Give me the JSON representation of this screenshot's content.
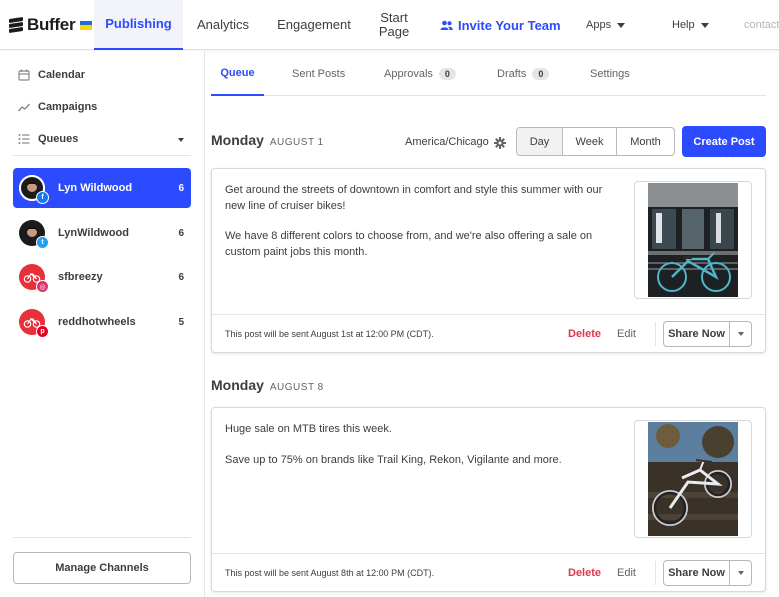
{
  "brand": {
    "name": "Buffer",
    "flag_colors": [
      "#1f6cd3",
      "#ffd500"
    ]
  },
  "nav": {
    "tabs": [
      {
        "label": "Publishing",
        "active": true
      },
      {
        "label": "Analytics"
      },
      {
        "label": "Engagement"
      },
      {
        "label": "Start Page"
      }
    ],
    "invite": "Invite Your Team",
    "apps": "Apps",
    "help": "Help",
    "contact": "contact"
  },
  "sidebar": {
    "calendar": "Calendar",
    "campaigns": "Campaigns",
    "queues": "Queues",
    "channels": [
      {
        "name": "Lyn Wildwood",
        "count": "6",
        "network": "facebook",
        "badge_color": "#1877f2",
        "active": true
      },
      {
        "name": "LynWildwood",
        "count": "6",
        "network": "twitter",
        "badge_color": "#1da1f2"
      },
      {
        "name": "sfbreezy",
        "count": "6",
        "network": "instagram",
        "badge_color": "#e1306c"
      },
      {
        "name": "reddhotwheels",
        "count": "5",
        "network": "pinterest",
        "badge_color": "#e60023"
      }
    ],
    "manage_label": "Manage Channels"
  },
  "tabs": {
    "queue": "Queue",
    "sent": "Sent Posts",
    "approvals": "Approvals",
    "approvals_count": "0",
    "drafts": "Drafts",
    "drafts_count": "0",
    "settings": "Settings"
  },
  "toolbar": {
    "timezone": "America/Chicago",
    "views": [
      "Day",
      "Week",
      "Month"
    ],
    "selected_view": "Day",
    "create_label": "Create Post"
  },
  "days": [
    {
      "name": "Monday",
      "date": "AUGUST 1",
      "post": {
        "paragraphs": [
          "Get around the streets of downtown in comfort and style this summer with our new line of cruiser bikes!",
          "We have 8 different colors to choose from, and we're also offering a sale on custom paint jobs this month."
        ],
        "note": "This post will be sent August 1st at 12:00 PM (CDT).",
        "image": "cruiser-bike-photo"
      }
    },
    {
      "name": "Monday",
      "date": "AUGUST 8",
      "post": {
        "paragraphs": [
          "Huge sale on MTB tires this week.",
          "Save up to 75% on brands like Trail King, Rekon, Vigilante and more."
        ],
        "note": "This post will be sent August 8th at 12:00 PM (CDT).",
        "image": "mountain-bike-photo"
      }
    }
  ],
  "post_actions": {
    "delete": "Delete",
    "edit": "Edit",
    "share": "Share Now"
  },
  "colors": {
    "accent": "#2c4bff",
    "danger": "#e0364f"
  }
}
